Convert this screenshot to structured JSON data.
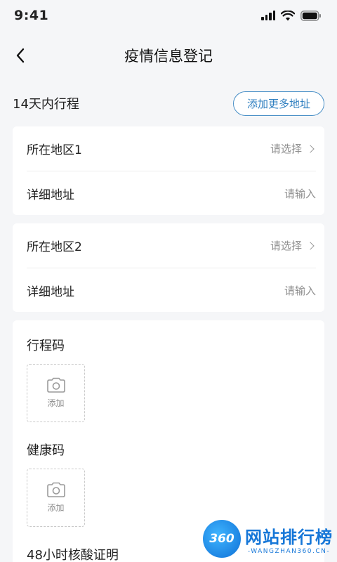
{
  "status_bar": {
    "time": "9:41"
  },
  "header": {
    "title": "疫情信息登记"
  },
  "itinerary": {
    "title": "14天内行程",
    "add_button": "添加更多地址",
    "groups": [
      {
        "region_label": "所在地区1",
        "region_value": "请选择",
        "address_label": "详细地址",
        "address_value": "请输入"
      },
      {
        "region_label": "所在地区2",
        "region_value": "请选择",
        "address_label": "详细地址",
        "address_value": "请输入"
      }
    ]
  },
  "uploads": [
    {
      "title": "行程码",
      "add_label": "添加"
    },
    {
      "title": "健康码",
      "add_label": "添加"
    },
    {
      "title": "48小时核酸证明"
    }
  ],
  "watermark": {
    "logo_text": "360",
    "main": "网站排行榜",
    "sub": "-WANGZHAN360.CN-"
  }
}
